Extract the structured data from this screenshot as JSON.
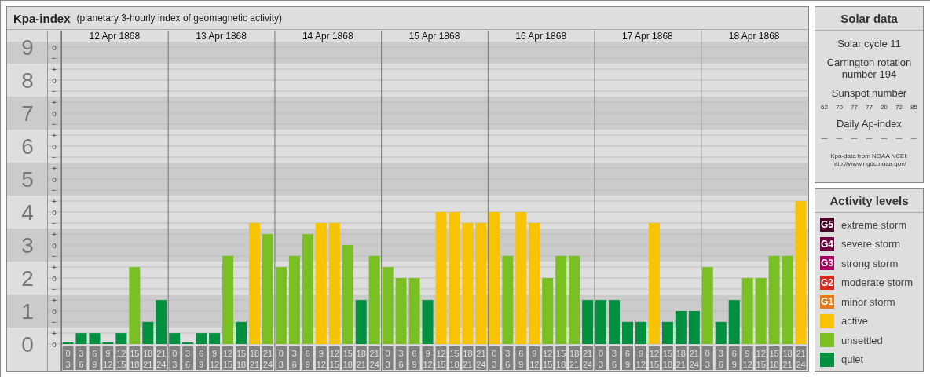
{
  "header": {
    "title": "Kpa-index",
    "subtitle": "(planetary 3-hourly index of geomagnetic activity)"
  },
  "chart": {
    "days": [
      {
        "date": "12 Apr 1868",
        "slots": [
          {
            "start": "0",
            "end": "3"
          },
          {
            "start": "3",
            "end": "6"
          },
          {
            "start": "6",
            "end": "9"
          },
          {
            "start": "9",
            "end": "12"
          },
          {
            "start": "12",
            "end": "15"
          },
          {
            "start": "15",
            "end": "18"
          },
          {
            "start": "18",
            "end": "21"
          },
          {
            "start": "21",
            "end": "24"
          }
        ]
      },
      {
        "date": "13 Apr 1868",
        "slots": [
          {
            "start": "0",
            "end": "3"
          },
          {
            "start": "3",
            "end": "6"
          },
          {
            "start": "6",
            "end": "9"
          },
          {
            "start": "9",
            "end": "12"
          },
          {
            "start": "12",
            "end": "15"
          },
          {
            "start": "15",
            "end": "18"
          },
          {
            "start": "18",
            "end": "21"
          },
          {
            "start": "21",
            "end": "24"
          }
        ]
      },
      {
        "date": "14 Apr 1868",
        "slots": [
          {
            "start": "0",
            "end": "3"
          },
          {
            "start": "3",
            "end": "6"
          },
          {
            "start": "6",
            "end": "9"
          },
          {
            "start": "9",
            "end": "12"
          },
          {
            "start": "12",
            "end": "15"
          },
          {
            "start": "15",
            "end": "18"
          },
          {
            "start": "18",
            "end": "21"
          },
          {
            "start": "21",
            "end": "24"
          }
        ]
      },
      {
        "date": "15 Apr 1868",
        "slots": [
          {
            "start": "0",
            "end": "3"
          },
          {
            "start": "3",
            "end": "6"
          },
          {
            "start": "6",
            "end": "9"
          },
          {
            "start": "9",
            "end": "12"
          },
          {
            "start": "12",
            "end": "15"
          },
          {
            "start": "15",
            "end": "18"
          },
          {
            "start": "18",
            "end": "21"
          },
          {
            "start": "21",
            "end": "24"
          }
        ]
      },
      {
        "date": "16 Apr 1868",
        "slots": [
          {
            "start": "0",
            "end": "3"
          },
          {
            "start": "3",
            "end": "6"
          },
          {
            "start": "6",
            "end": "9"
          },
          {
            "start": "9",
            "end": "12"
          },
          {
            "start": "12",
            "end": "15"
          },
          {
            "start": "15",
            "end": "18"
          },
          {
            "start": "18",
            "end": "21"
          },
          {
            "start": "21",
            "end": "24"
          }
        ]
      },
      {
        "date": "17 Apr 1868",
        "slots": [
          {
            "start": "0",
            "end": "3"
          },
          {
            "start": "3",
            "end": "6"
          },
          {
            "start": "6",
            "end": "9"
          },
          {
            "start": "9",
            "end": "12"
          },
          {
            "start": "12",
            "end": "15"
          },
          {
            "start": "15",
            "end": "18"
          },
          {
            "start": "18",
            "end": "21"
          },
          {
            "start": "21",
            "end": "24"
          }
        ]
      },
      {
        "date": "18 Apr 1868",
        "slots": [
          {
            "start": "0",
            "end": "3"
          },
          {
            "start": "3",
            "end": "6"
          },
          {
            "start": "6",
            "end": "9"
          },
          {
            "start": "9",
            "end": "12"
          },
          {
            "start": "12",
            "end": "15"
          },
          {
            "start": "15",
            "end": "18"
          },
          {
            "start": "18",
            "end": "21"
          },
          {
            "start": "21",
            "end": "24"
          }
        ]
      }
    ],
    "minor_ticks": [
      "o",
      "−",
      "+",
      "o",
      "−",
      "+",
      "o",
      "−",
      "+",
      "o",
      "−",
      "+",
      "o",
      "−",
      "+",
      "o",
      "−",
      "+",
      "o",
      "−",
      "+",
      "o",
      "−",
      "+",
      "o",
      "−",
      "+",
      "o"
    ],
    "chart_data": {
      "type": "bar",
      "ylim": [
        0,
        9.5
      ],
      "grid": true,
      "yticks": [
        0,
        1,
        2,
        3,
        4,
        5,
        6,
        7,
        8,
        9
      ],
      "values": [
        0,
        0.33,
        0.33,
        0,
        0.33,
        2.33,
        0.67,
        1.33,
        0.33,
        0,
        0.33,
        0.33,
        2.67,
        0.67,
        3.67,
        3.33,
        2.33,
        2.67,
        3.33,
        3.67,
        3.67,
        3,
        1.33,
        2.67,
        2.33,
        2,
        2,
        1.33,
        4,
        4,
        3.67,
        3.67,
        4,
        2.67,
        4,
        3.67,
        2,
        2.67,
        2.67,
        1.33,
        1.33,
        1.33,
        0.67,
        0.67,
        3.67,
        0.67,
        1,
        1,
        2.33,
        0.67,
        1.33,
        2,
        2,
        2.67,
        2.67,
        4.33
      ]
    }
  },
  "solar_data": {
    "title": "Solar data",
    "cycle": "Solar cycle 11",
    "rotation": "Carrington rotation number 194",
    "sunspot_title": "Sunspot number",
    "sunspots": [
      "62",
      "70",
      "77",
      "77",
      "20",
      "72",
      "85"
    ],
    "ap_title": "Daily Ap-index",
    "ap_values": [
      "—",
      "—",
      "—",
      "—",
      "—",
      "—",
      "—"
    ],
    "source": "Kpa-data from NOAA NCEI:",
    "source_url": "http://www.ngdc.noaa.gov/"
  },
  "activity_levels": {
    "title": "Activity levels",
    "items": [
      {
        "badge": "G5",
        "label": "extreme storm",
        "color": "#4a0028"
      },
      {
        "badge": "G4",
        "label": "severe storm",
        "color": "#6e0040"
      },
      {
        "badge": "G3",
        "label": "strong storm",
        "color": "#a8005c"
      },
      {
        "badge": "G2",
        "label": "moderate storm",
        "color": "#d62a1c"
      },
      {
        "badge": "G1",
        "label": "minor storm",
        "color": "#e87a18"
      },
      {
        "label": "active",
        "color": "#f8c300"
      },
      {
        "label": "unsettled",
        "color": "#7bc023"
      },
      {
        "label": "quiet",
        "color": "#009040"
      }
    ]
  }
}
